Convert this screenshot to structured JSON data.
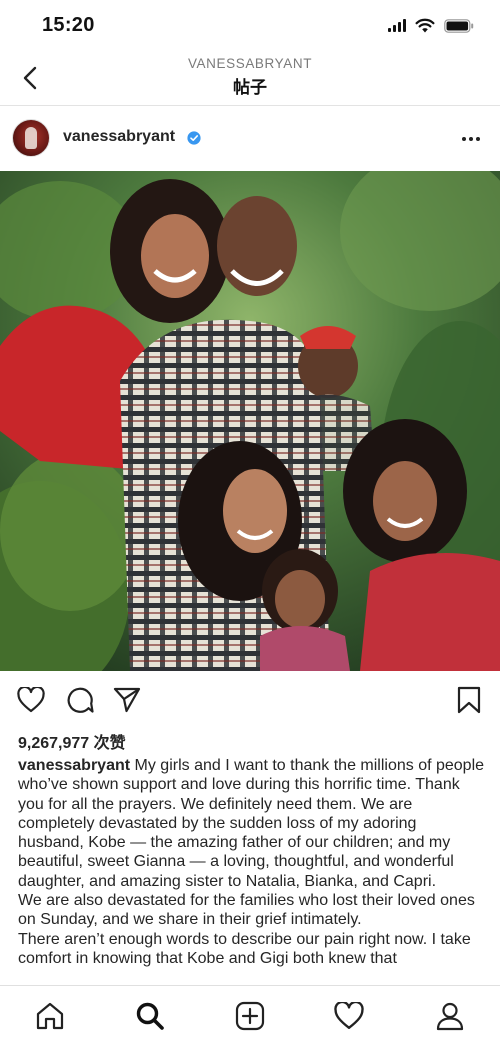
{
  "status_bar": {
    "time": "15:20"
  },
  "header": {
    "username": "VANESSABRYANT",
    "title": "帖子"
  },
  "post": {
    "username": "vanessabryant",
    "likes_count": "9,267,977",
    "likes_suffix": "次赞",
    "caption_username": "vanessabryant",
    "caption_p1": "My girls and I want to thank the millions of people who’ve shown support and love during this horrific time. Thank you for all the prayers. We definitely need them. We are completely devastated by the sudden loss of my adoring husband, Kobe — the amazing father of our children; and my beautiful, sweet Gianna — a loving, thoughtful, and wonderful daughter, and amazing sister to Natalia, Bianka, and Capri.",
    "caption_p2": "We are also devastated for the families who lost their loved ones on Sunday, and we share in their grief intimately.",
    "caption_p3": "There aren’t enough words to describe our pain right now. I take comfort in knowing that Kobe and Gigi both knew that"
  },
  "icons": {
    "back": "chevron-left-icon",
    "verified": "verified-badge-icon",
    "more": "more-horizontal-icon",
    "like": "heart-icon",
    "comment": "comment-icon",
    "share": "send-icon",
    "save": "bookmark-icon",
    "home": "home-icon",
    "search": "search-icon",
    "create": "plus-square-icon",
    "activity": "heart-icon",
    "profile": "person-icon"
  },
  "colors": {
    "verified_blue": "#3897f0",
    "text": "#262626",
    "secondary": "#7a7a7a"
  }
}
